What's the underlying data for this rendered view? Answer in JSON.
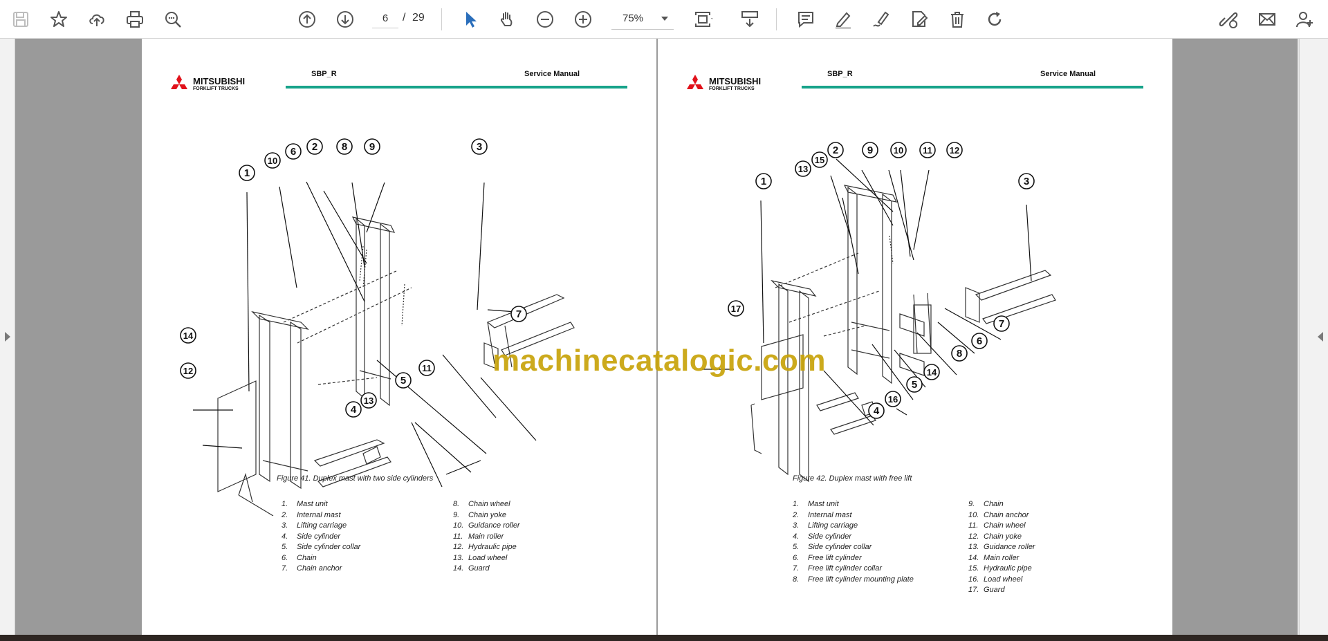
{
  "toolbar": {
    "icons": [
      "save-icon",
      "bookmark-star-icon",
      "upload-cloud-icon",
      "print-icon",
      "find-zoom-icon",
      "previous-page-icon",
      "next-page-icon",
      "select-cursor-icon",
      "hand-pan-icon",
      "zoom-out-icon",
      "zoom-in-icon",
      "fit-page-icon",
      "scroll-mode-icon",
      "comment-icon",
      "highlight-icon",
      "draw-icon",
      "edit-icon",
      "delete-icon",
      "rotate-icon",
      "share-link-icon",
      "mail-icon",
      "account-icon"
    ],
    "page_current": "6",
    "page_separator": "/",
    "page_total": "29",
    "zoom": "75%",
    "accent_color": "#2a6ebb"
  },
  "header": {
    "code": "SBP_R",
    "manual": "Service Manual",
    "brand_color": "#e1121b",
    "rule_color": "#17a38a"
  },
  "pages": [
    {
      "figure_caption": "Figure 41. Duplex mast with two side cylinders",
      "callouts": [
        "1",
        "2",
        "3",
        "4",
        "5",
        "6",
        "7",
        "8",
        "9",
        "10",
        "11",
        "12",
        "13",
        "14"
      ],
      "parts_left": [
        {
          "num": "1.",
          "name": "Mast unit"
        },
        {
          "num": "2.",
          "name": "Internal mast"
        },
        {
          "num": "3.",
          "name": "Lifting carriage"
        },
        {
          "num": "4.",
          "name": "Side cylinder"
        },
        {
          "num": "5.",
          "name": "Side cylinder collar"
        },
        {
          "num": "6.",
          "name": "Chain"
        },
        {
          "num": "7.",
          "name": "Chain anchor"
        }
      ],
      "parts_right": [
        {
          "num": "8.",
          "name": "Chain wheel"
        },
        {
          "num": "9.",
          "name": "Chain yoke"
        },
        {
          "num": "10.",
          "name": "Guidance roller"
        },
        {
          "num": "11.",
          "name": "Main roller"
        },
        {
          "num": "12.",
          "name": "Hydraulic pipe"
        },
        {
          "num": "13.",
          "name": "Load wheel"
        },
        {
          "num": "14.",
          "name": "Guard"
        }
      ]
    },
    {
      "figure_caption": "Figure 42. Duplex mast with free lift",
      "callouts": [
        "1",
        "2",
        "3",
        "4",
        "5",
        "6",
        "7",
        "8",
        "9",
        "10",
        "11",
        "12",
        "13",
        "14",
        "15",
        "16",
        "17"
      ],
      "parts_left": [
        {
          "num": "1.",
          "name": "Mast unit"
        },
        {
          "num": "2.",
          "name": "Internal mast"
        },
        {
          "num": "3.",
          "name": "Lifting carriage"
        },
        {
          "num": "4.",
          "name": "Side cylinder"
        },
        {
          "num": "5.",
          "name": "Side cylinder collar"
        },
        {
          "num": "6.",
          "name": "Free lift cylinder"
        },
        {
          "num": "7.",
          "name": "Free lift cylinder collar"
        },
        {
          "num": "8.",
          "name": "Free lift cylinder mounting plate"
        }
      ],
      "parts_right": [
        {
          "num": "9.",
          "name": "Chain"
        },
        {
          "num": "10.",
          "name": "Chain anchor"
        },
        {
          "num": "11.",
          "name": "Chain wheel"
        },
        {
          "num": "12.",
          "name": "Chain yoke"
        },
        {
          "num": "13.",
          "name": "Guidance roller"
        },
        {
          "num": "14.",
          "name": "Main roller"
        },
        {
          "num": "15.",
          "name": "Hydraulic pipe"
        },
        {
          "num": "16.",
          "name": "Load wheel"
        },
        {
          "num": "17.",
          "name": "Guard"
        }
      ]
    }
  ],
  "watermark": "machinecatalogic.com"
}
